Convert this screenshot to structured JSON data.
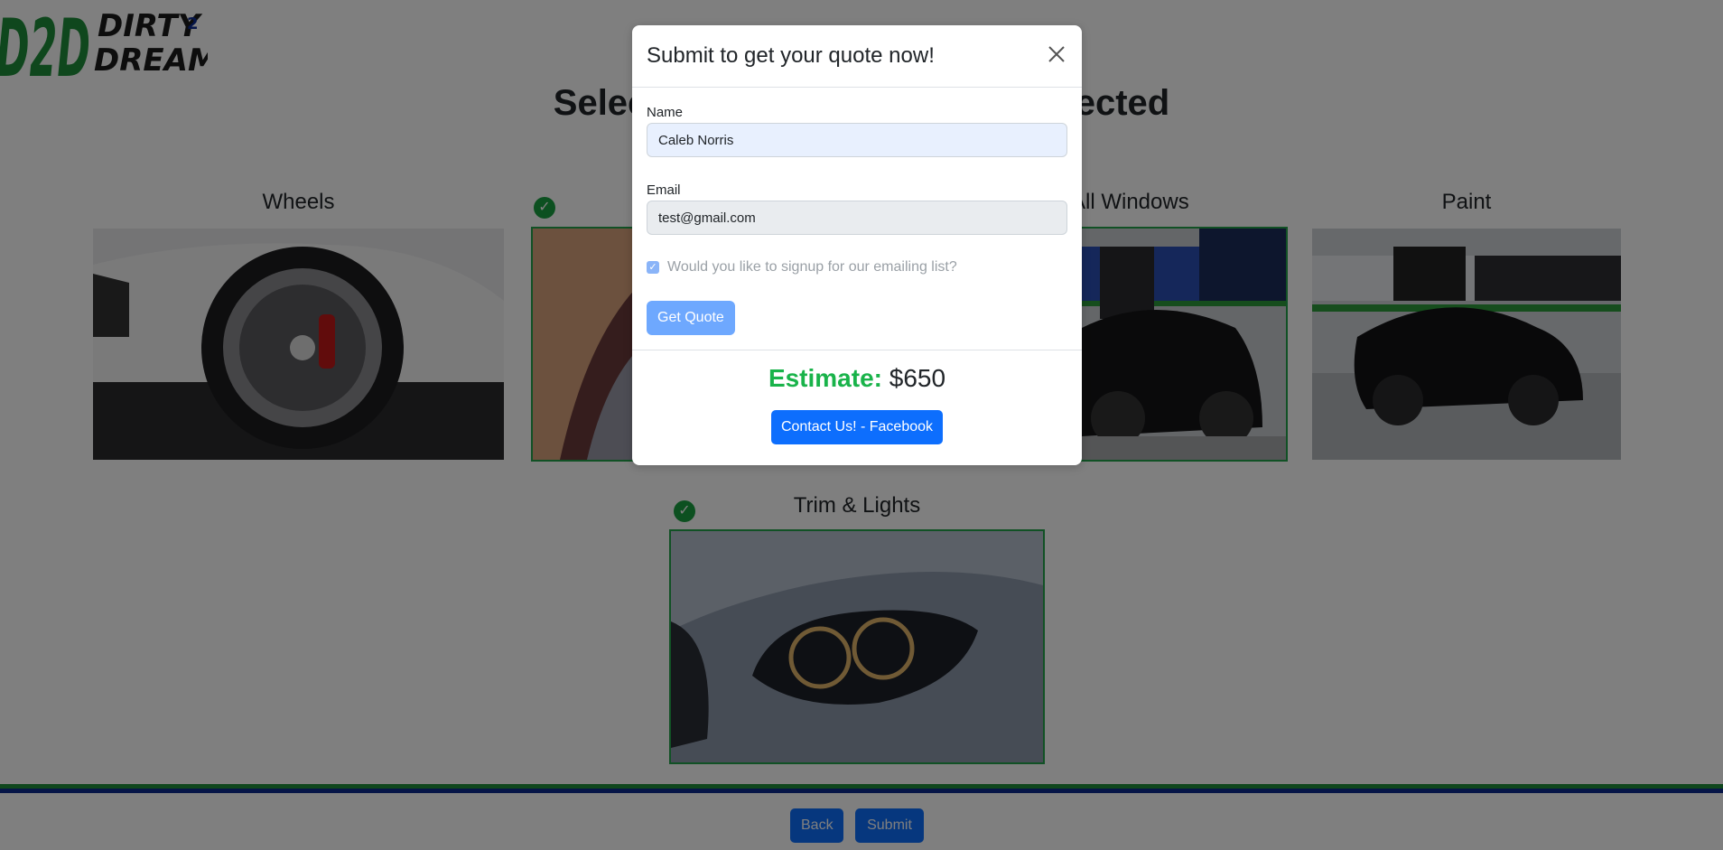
{
  "brand": {
    "logo_line1": "DIRTY",
    "logo_sup": "2",
    "logo_line2": "DREAMY",
    "logo_mark": "D2D"
  },
  "page": {
    "heading": "Select the areas you want protected"
  },
  "cards": [
    {
      "title": "Wheels",
      "selected": false,
      "image": "white-bmw-wheel-photo"
    },
    {
      "title": "",
      "selected": true,
      "image": "red-car-detail-photo"
    },
    {
      "title": "All Windows",
      "selected": true,
      "image": "black-audi-in-shop-photo"
    },
    {
      "title": "Paint",
      "selected": false,
      "image": "black-sports-car-in-shop-photo"
    },
    {
      "title": "Trim & Lights",
      "selected": true,
      "image": "bmw-headlight-photo"
    }
  ],
  "footer": {
    "back_label": "Back",
    "submit_label": "Submit"
  },
  "modal": {
    "title": "Submit to get your quote now!",
    "name_label": "Name",
    "name_value": "Caleb Norris",
    "email_label": "Email",
    "email_value": "test@gmail.com",
    "checkbox_label": "Would you like to signup for our emailing list?",
    "checkbox_checked": true,
    "get_quote_label": "Get Quote",
    "estimate_label": "Estimate:",
    "estimate_value": "$650",
    "contact_label": "Contact Us! - Facebook"
  },
  "colors": {
    "primary": "#0d6efd",
    "primary_disabled": "#6ea8fe",
    "estimate_green": "#19b34a",
    "check_green": "#19a140",
    "brand_green": "#1f8f3a",
    "brand_blue": "#0d2a8f"
  }
}
